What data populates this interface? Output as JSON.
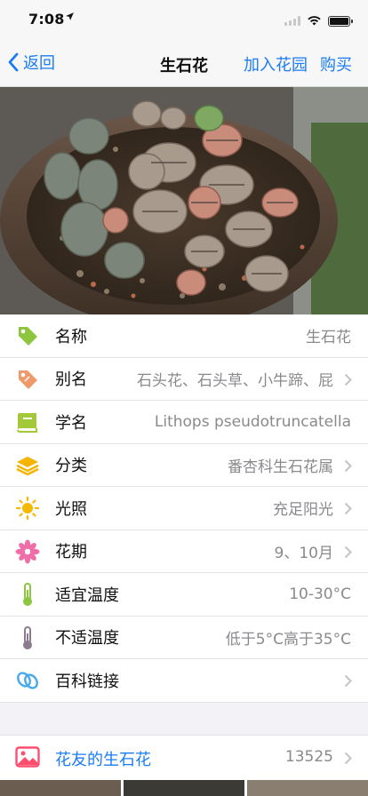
{
  "status_bar": {
    "time": "7:08"
  },
  "navbar": {
    "back_label": "返回",
    "title": "生石花",
    "add_to_garden": "加入花园",
    "buy": "购买"
  },
  "details": [
    {
      "label": "名称",
      "value": "生石花",
      "icon": "tag-icon",
      "chevron": false
    },
    {
      "label": "别名",
      "value": "石头花、石头草、小牛蹄、屁",
      "icon": "price-tag-icon",
      "chevron": true
    },
    {
      "label": "学名",
      "value": "Lithops pseudotruncatella",
      "icon": "book-icon",
      "chevron": false
    },
    {
      "label": "分类",
      "value": "番杏科生石花属",
      "icon": "layers-icon",
      "chevron": true
    },
    {
      "label": "光照",
      "value": "充足阳光",
      "icon": "sun-icon",
      "chevron": true
    },
    {
      "label": "花期",
      "value": "9、10月",
      "icon": "flower-icon",
      "chevron": true
    },
    {
      "label": "适宜温度",
      "value": "10-30°C",
      "icon": "thermometer-green-icon",
      "chevron": false
    },
    {
      "label": "不适温度",
      "value": "低于5°C高于35°C",
      "icon": "thermometer-purple-icon",
      "chevron": false
    },
    {
      "label": "百科链接",
      "value": "",
      "icon": "link-icon",
      "chevron": true
    }
  ],
  "friends": {
    "label": "花友的生石花",
    "count": "13525",
    "icon": "photo-icon"
  },
  "colors": {
    "accent": "#1a7cf5"
  }
}
